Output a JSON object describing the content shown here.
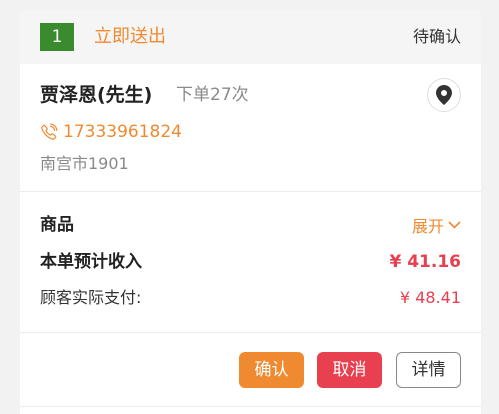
{
  "order": {
    "number": "1",
    "delivery_tag": "立即送出",
    "status": "待确认"
  },
  "customer": {
    "name": "贾泽恩(先生)",
    "order_count": "下单27次",
    "phone": "17333961824",
    "address": "南宫市1901"
  },
  "goods": {
    "label": "商品",
    "expand_label": "展开"
  },
  "income": {
    "label": "本单预计收入",
    "value": "¥ 41.16"
  },
  "paid": {
    "label": "顾客实际支付:",
    "value": "¥ 48.41"
  },
  "actions": {
    "confirm": "确认",
    "cancel": "取消",
    "detail": "详情"
  },
  "colors": {
    "accent": "#f08a30",
    "price": "#e8404f",
    "order_badge": "#3a8a2e"
  },
  "icons": {
    "location": "location-pin-icon",
    "phone": "phone-icon",
    "expand": "chevron-down-icon"
  }
}
